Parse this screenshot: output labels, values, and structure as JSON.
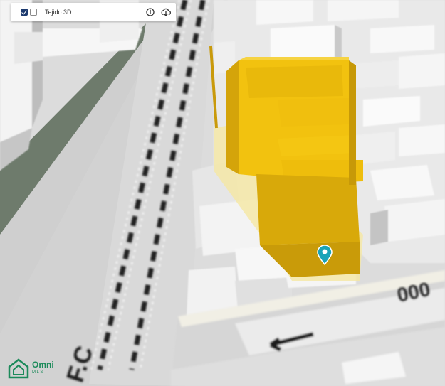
{
  "layers_panel": {
    "checkbox_1_checked": true,
    "checkbox_2_checked": false,
    "layer_name": "Tejido 3D",
    "info_icon": "info-icon",
    "download_icon": "cloud-download-icon"
  },
  "map": {
    "street_number_text": "000",
    "street_sign_text": "F.C",
    "selected_building_color": "#f2c20f",
    "marker_color": "#1aa3b8",
    "road_arrow": "arrow-left"
  },
  "logo": {
    "name": "Omni",
    "sub": "MLS",
    "color": "#1c8a5a"
  }
}
